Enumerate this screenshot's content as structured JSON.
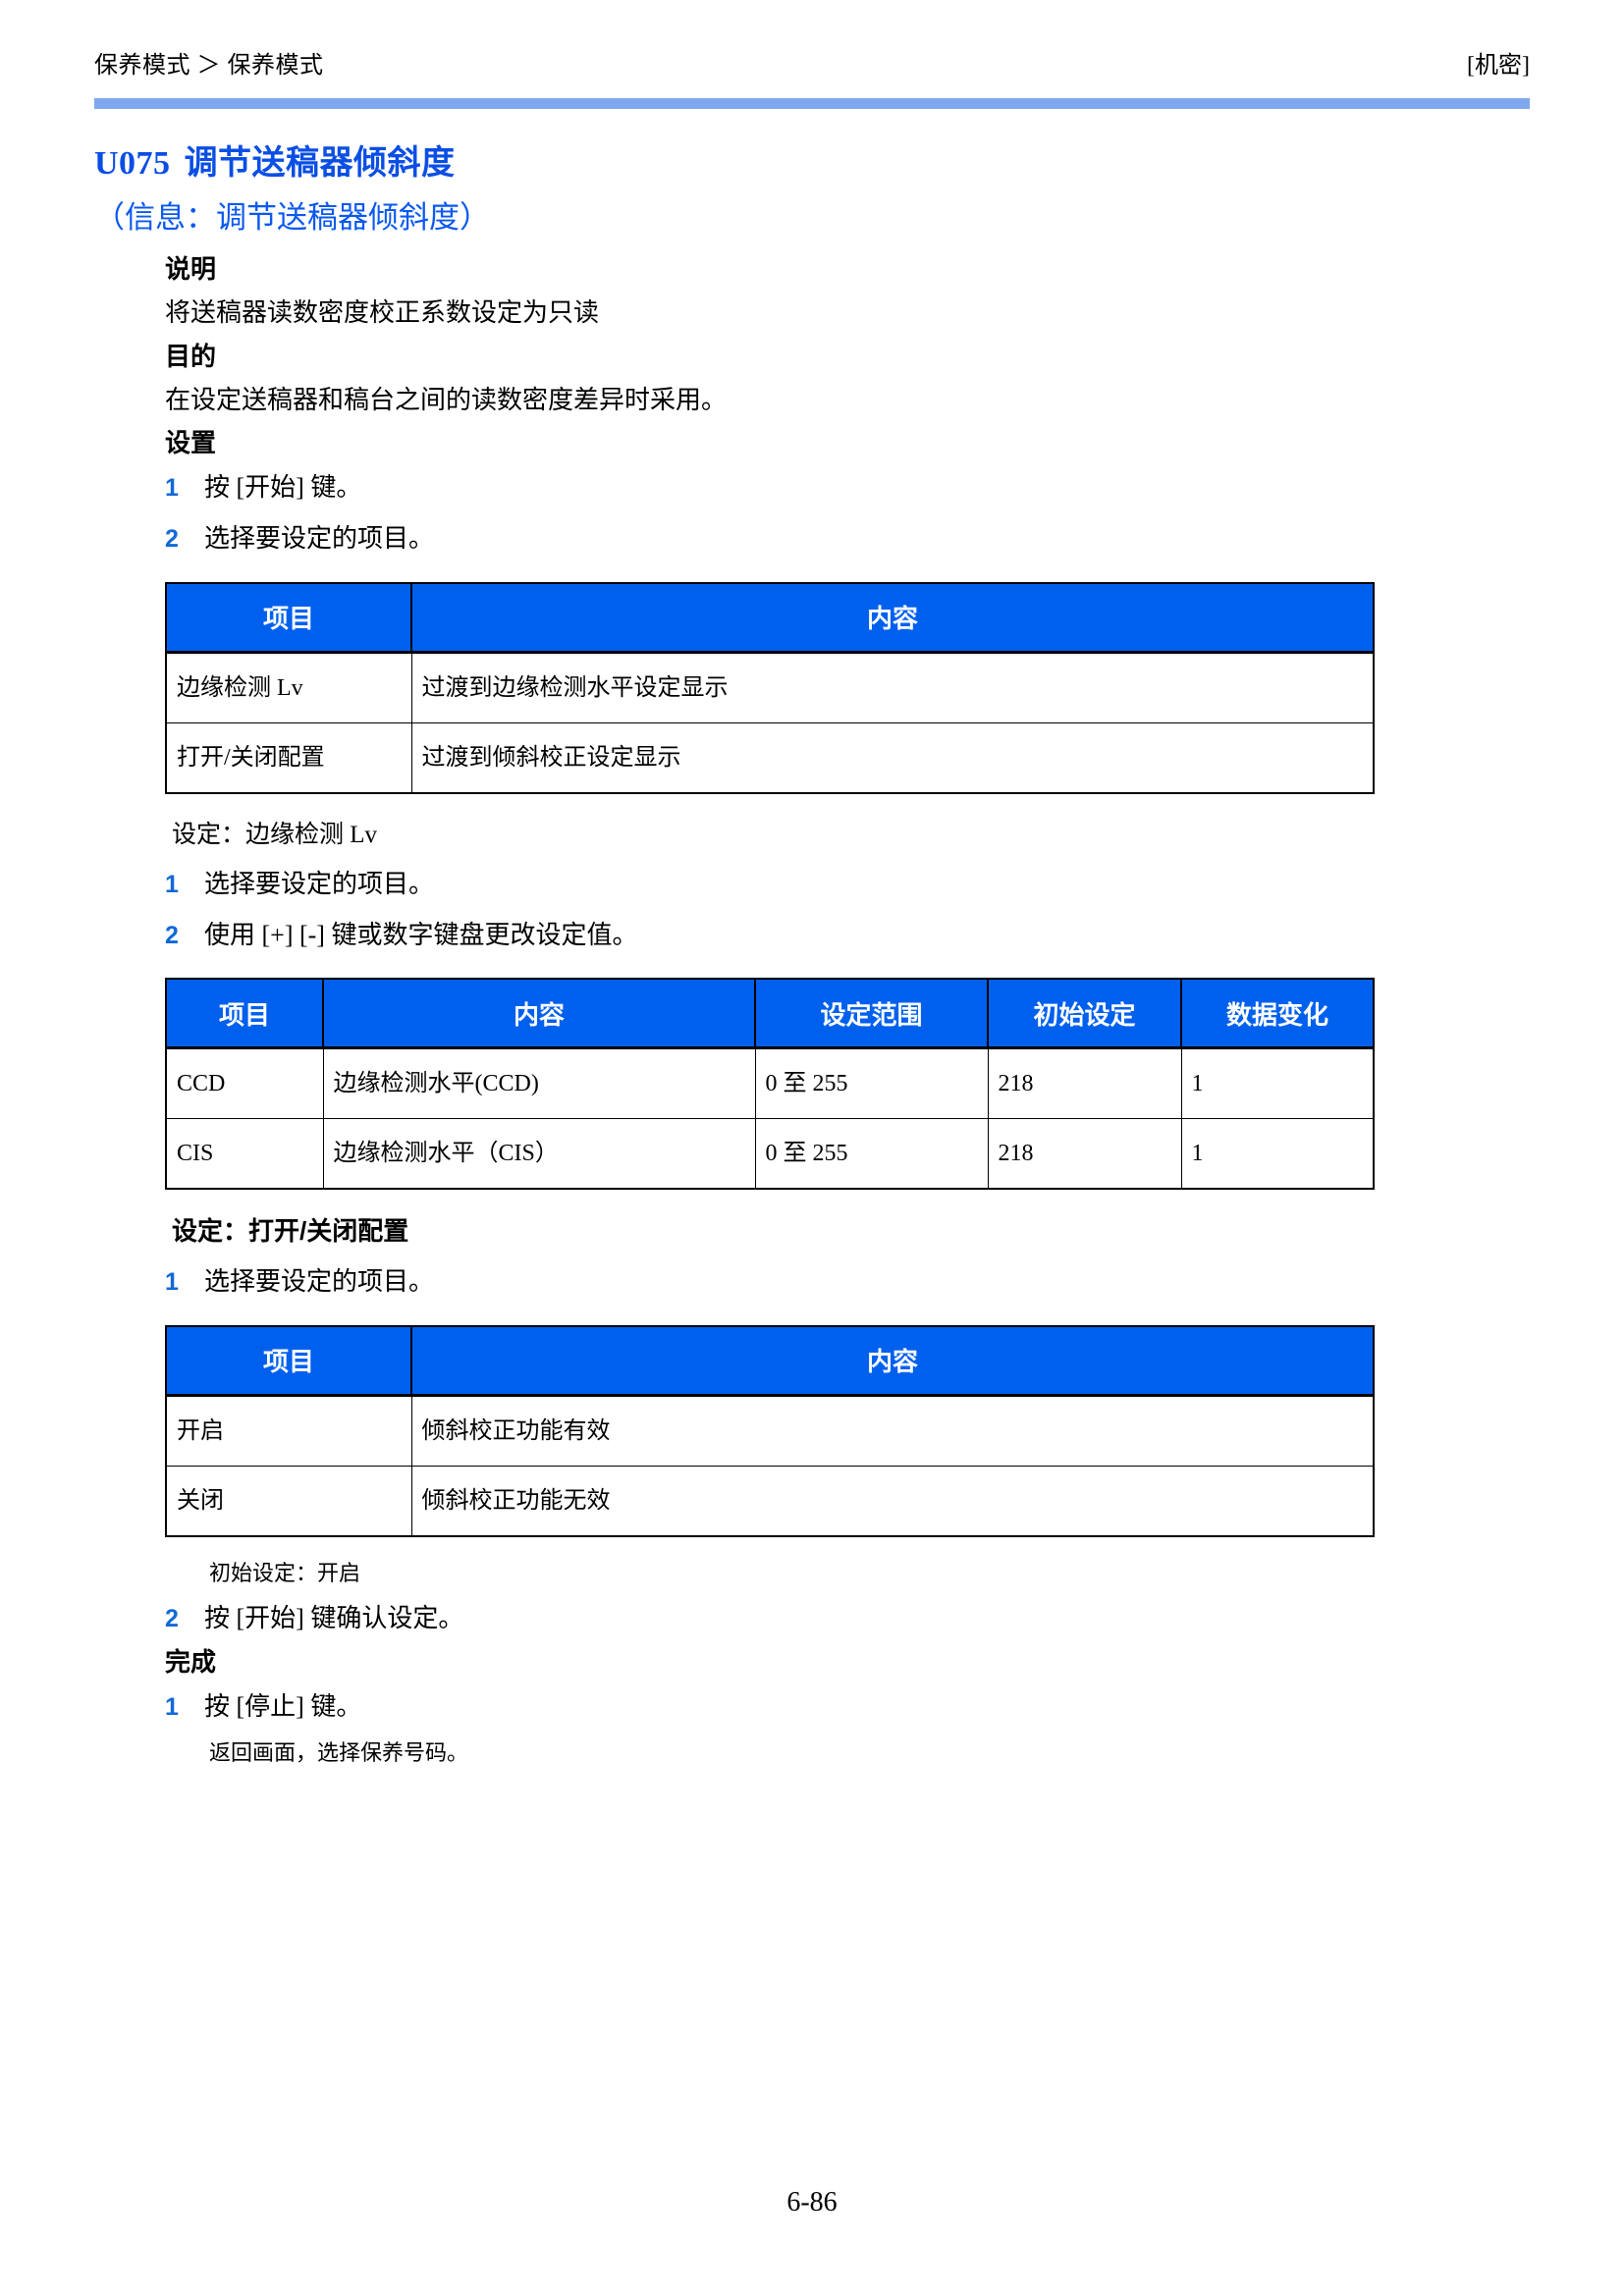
{
  "header": {
    "breadcrumb": "保养模式 ＞ 保养模式",
    "classification": "[机密]"
  },
  "title": {
    "code": "U075",
    "name": "调节送稿器倾斜度",
    "subtitle": "（信息：调节送稿器倾斜度）"
  },
  "sections": {
    "description_heading": "说明",
    "description_text": "将送稿器读数密度校正系数设定为只读",
    "purpose_heading": "目的",
    "purpose_text": "在设定送稿器和稿台之间的读数密度差异时采用。",
    "setting_heading": "设置",
    "complete_heading": "完成"
  },
  "steps": {
    "setting_1_num": "1",
    "setting_1_text": "按 [开始] 键。",
    "setting_2_num": "2",
    "setting_2_text": "选择要设定的项目。",
    "edge_label": "设定：边缘检测 Lv",
    "edge_1_num": "1",
    "edge_1_text": "选择要设定的项目。",
    "edge_2_num": "2",
    "edge_2_text": "使用 [+] [-] 键或数字键盘更改设定值。",
    "onoff_label": "设定：打开/关闭配置",
    "onoff_1_num": "1",
    "onoff_1_text": "选择要设定的项目。",
    "onoff_default_note": "初始设定：开启",
    "onoff_2_num": "2",
    "onoff_2_text": "按 [开始] 键确认设定。",
    "complete_1_num": "1",
    "complete_1_text": "按 [停止] 键。",
    "complete_note": "返回画面，选择保养号码。"
  },
  "table_menu": {
    "headers": [
      "项目",
      "内容"
    ],
    "rows": [
      [
        "边缘检测 Lv",
        "过渡到边缘检测水平设定显示"
      ],
      [
        "打开/关闭配置",
        "过渡到倾斜校正设定显示"
      ]
    ]
  },
  "table_edge": {
    "headers": [
      "项目",
      "内容",
      "设定范围",
      "初始设定",
      "数据变化"
    ],
    "rows": [
      [
        "CCD",
        "边缘检测水平(CCD)",
        "0 至 255",
        "218",
        "1"
      ],
      [
        "CIS",
        "边缘检测水平（CIS）",
        "0 至 255",
        "218",
        "1"
      ]
    ]
  },
  "table_onoff": {
    "headers": [
      "项目",
      "内容"
    ],
    "rows": [
      [
        "开启",
        "倾斜校正功能有效"
      ],
      [
        "关闭",
        "倾斜校正功能无效"
      ]
    ]
  },
  "footer": {
    "page_number": "6-86"
  },
  "colors": {
    "header_rule": "#80a8f0",
    "title_blue": "#0a4ee4",
    "table_header_blue": "#0060ee",
    "step_number_blue": "#1168d8"
  }
}
